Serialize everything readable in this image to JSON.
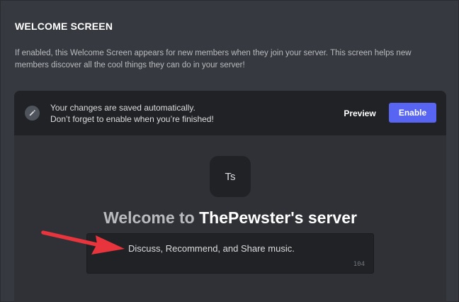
{
  "section": {
    "title": "WELCOME SCREEN",
    "description": "If enabled, this Welcome Screen appears for new members when they join your server. This screen helps new members discover all the cool things they can do in your server!"
  },
  "notice": {
    "line1": "Your changes are saved automatically.",
    "line2": "Don’t forget to enable when you’re finished!",
    "icon": "pencil-icon"
  },
  "actions": {
    "preview_label": "Preview",
    "enable_label": "Enable"
  },
  "server": {
    "initials": "Ts",
    "welcome_prefix": "Welcome to ",
    "name": "ThePewster's server"
  },
  "description_field": {
    "value": "Discuss, Recommend, and Share music.",
    "char_count": "104"
  },
  "colors": {
    "background": "#36393f",
    "card": "#2f3136",
    "bar": "#202225",
    "accent": "#5865f2",
    "annotation_arrow": "#e8343c"
  }
}
